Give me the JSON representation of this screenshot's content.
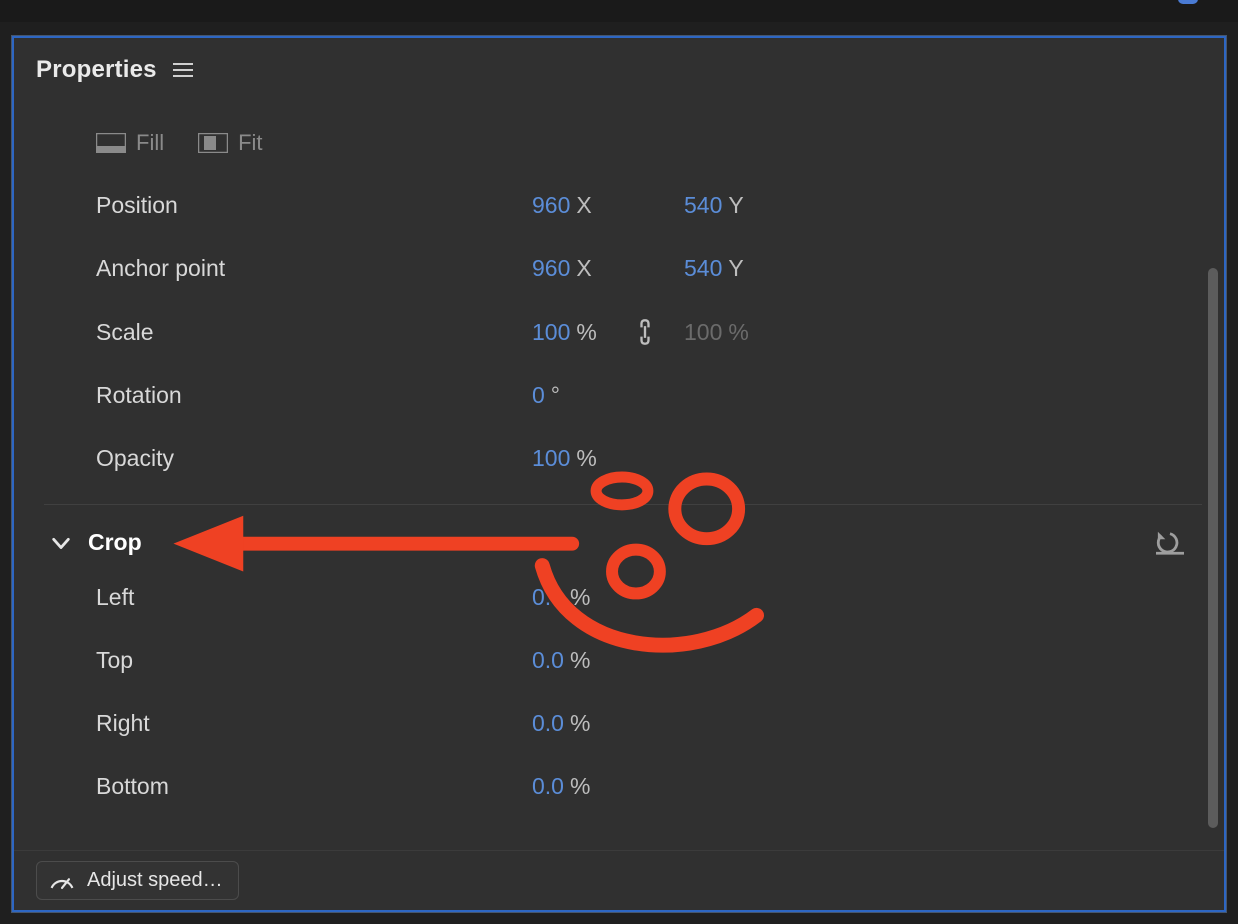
{
  "panel": {
    "title": "Properties"
  },
  "fillfit": {
    "fill": "Fill",
    "fit": "Fit"
  },
  "transform": {
    "position": {
      "label": "Position",
      "x": "960",
      "xunit": "X",
      "y": "540",
      "yunit": "Y"
    },
    "anchor": {
      "label": "Anchor point",
      "x": "960",
      "xunit": "X",
      "y": "540",
      "yunit": "Y"
    },
    "scale": {
      "label": "Scale",
      "a": "100",
      "aunit": "%",
      "b": "100",
      "bunit": "%"
    },
    "rotation": {
      "label": "Rotation",
      "val": "0",
      "unit": "°"
    },
    "opacity": {
      "label": "Opacity",
      "val": "100",
      "unit": "%"
    }
  },
  "crop": {
    "section": "Crop",
    "left": {
      "label": "Left",
      "val": "0.0",
      "unit": "%"
    },
    "top": {
      "label": "Top",
      "val": "0.0",
      "unit": "%"
    },
    "right": {
      "label": "Right",
      "val": "0.0",
      "unit": "%"
    },
    "bottom": {
      "label": "Bottom",
      "val": "0.0",
      "unit": "%"
    }
  },
  "footer": {
    "speed": "Adjust speed…"
  }
}
